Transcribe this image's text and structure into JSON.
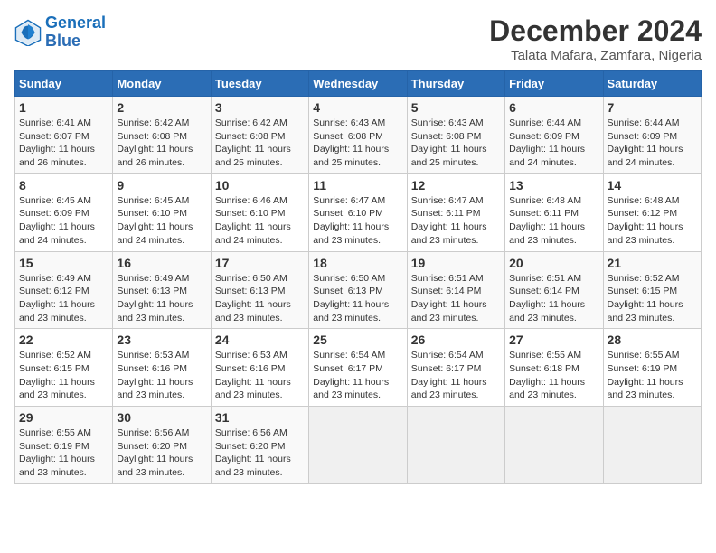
{
  "logo": {
    "line1": "General",
    "line2": "Blue"
  },
  "title": "December 2024",
  "location": "Talata Mafara, Zamfara, Nigeria",
  "headers": [
    "Sunday",
    "Monday",
    "Tuesday",
    "Wednesday",
    "Thursday",
    "Friday",
    "Saturday"
  ],
  "weeks": [
    [
      {
        "day": "1",
        "info": "Sunrise: 6:41 AM\nSunset: 6:07 PM\nDaylight: 11 hours\nand 26 minutes."
      },
      {
        "day": "2",
        "info": "Sunrise: 6:42 AM\nSunset: 6:08 PM\nDaylight: 11 hours\nand 26 minutes."
      },
      {
        "day": "3",
        "info": "Sunrise: 6:42 AM\nSunset: 6:08 PM\nDaylight: 11 hours\nand 25 minutes."
      },
      {
        "day": "4",
        "info": "Sunrise: 6:43 AM\nSunset: 6:08 PM\nDaylight: 11 hours\nand 25 minutes."
      },
      {
        "day": "5",
        "info": "Sunrise: 6:43 AM\nSunset: 6:08 PM\nDaylight: 11 hours\nand 25 minutes."
      },
      {
        "day": "6",
        "info": "Sunrise: 6:44 AM\nSunset: 6:09 PM\nDaylight: 11 hours\nand 24 minutes."
      },
      {
        "day": "7",
        "info": "Sunrise: 6:44 AM\nSunset: 6:09 PM\nDaylight: 11 hours\nand 24 minutes."
      }
    ],
    [
      {
        "day": "8",
        "info": "Sunrise: 6:45 AM\nSunset: 6:09 PM\nDaylight: 11 hours\nand 24 minutes."
      },
      {
        "day": "9",
        "info": "Sunrise: 6:45 AM\nSunset: 6:10 PM\nDaylight: 11 hours\nand 24 minutes."
      },
      {
        "day": "10",
        "info": "Sunrise: 6:46 AM\nSunset: 6:10 PM\nDaylight: 11 hours\nand 24 minutes."
      },
      {
        "day": "11",
        "info": "Sunrise: 6:47 AM\nSunset: 6:10 PM\nDaylight: 11 hours\nand 23 minutes."
      },
      {
        "day": "12",
        "info": "Sunrise: 6:47 AM\nSunset: 6:11 PM\nDaylight: 11 hours\nand 23 minutes."
      },
      {
        "day": "13",
        "info": "Sunrise: 6:48 AM\nSunset: 6:11 PM\nDaylight: 11 hours\nand 23 minutes."
      },
      {
        "day": "14",
        "info": "Sunrise: 6:48 AM\nSunset: 6:12 PM\nDaylight: 11 hours\nand 23 minutes."
      }
    ],
    [
      {
        "day": "15",
        "info": "Sunrise: 6:49 AM\nSunset: 6:12 PM\nDaylight: 11 hours\nand 23 minutes."
      },
      {
        "day": "16",
        "info": "Sunrise: 6:49 AM\nSunset: 6:13 PM\nDaylight: 11 hours\nand 23 minutes."
      },
      {
        "day": "17",
        "info": "Sunrise: 6:50 AM\nSunset: 6:13 PM\nDaylight: 11 hours\nand 23 minutes."
      },
      {
        "day": "18",
        "info": "Sunrise: 6:50 AM\nSunset: 6:13 PM\nDaylight: 11 hours\nand 23 minutes."
      },
      {
        "day": "19",
        "info": "Sunrise: 6:51 AM\nSunset: 6:14 PM\nDaylight: 11 hours\nand 23 minutes."
      },
      {
        "day": "20",
        "info": "Sunrise: 6:51 AM\nSunset: 6:14 PM\nDaylight: 11 hours\nand 23 minutes."
      },
      {
        "day": "21",
        "info": "Sunrise: 6:52 AM\nSunset: 6:15 PM\nDaylight: 11 hours\nand 23 minutes."
      }
    ],
    [
      {
        "day": "22",
        "info": "Sunrise: 6:52 AM\nSunset: 6:15 PM\nDaylight: 11 hours\nand 23 minutes."
      },
      {
        "day": "23",
        "info": "Sunrise: 6:53 AM\nSunset: 6:16 PM\nDaylight: 11 hours\nand 23 minutes."
      },
      {
        "day": "24",
        "info": "Sunrise: 6:53 AM\nSunset: 6:16 PM\nDaylight: 11 hours\nand 23 minutes."
      },
      {
        "day": "25",
        "info": "Sunrise: 6:54 AM\nSunset: 6:17 PM\nDaylight: 11 hours\nand 23 minutes."
      },
      {
        "day": "26",
        "info": "Sunrise: 6:54 AM\nSunset: 6:17 PM\nDaylight: 11 hours\nand 23 minutes."
      },
      {
        "day": "27",
        "info": "Sunrise: 6:55 AM\nSunset: 6:18 PM\nDaylight: 11 hours\nand 23 minutes."
      },
      {
        "day": "28",
        "info": "Sunrise: 6:55 AM\nSunset: 6:19 PM\nDaylight: 11 hours\nand 23 minutes."
      }
    ],
    [
      {
        "day": "29",
        "info": "Sunrise: 6:55 AM\nSunset: 6:19 PM\nDaylight: 11 hours\nand 23 minutes."
      },
      {
        "day": "30",
        "info": "Sunrise: 6:56 AM\nSunset: 6:20 PM\nDaylight: 11 hours\nand 23 minutes."
      },
      {
        "day": "31",
        "info": "Sunrise: 6:56 AM\nSunset: 6:20 PM\nDaylight: 11 hours\nand 23 minutes."
      },
      {
        "day": "",
        "info": ""
      },
      {
        "day": "",
        "info": ""
      },
      {
        "day": "",
        "info": ""
      },
      {
        "day": "",
        "info": ""
      }
    ]
  ]
}
